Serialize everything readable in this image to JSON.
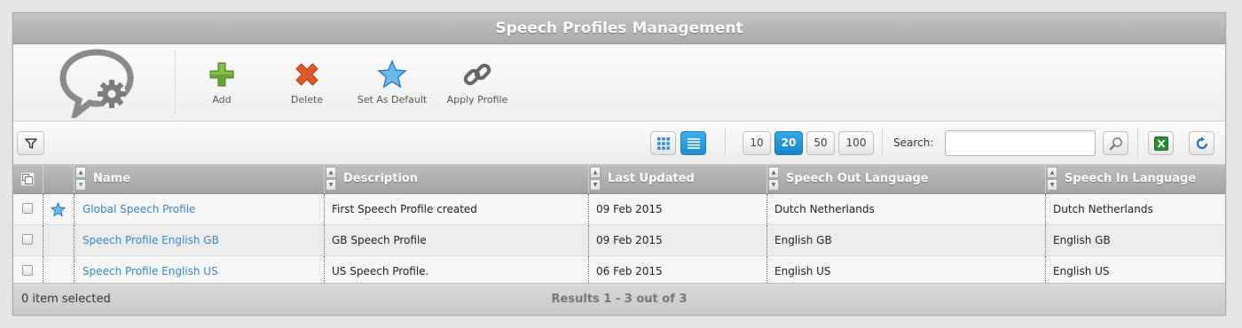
{
  "window": {
    "title": "Speech Profiles Management"
  },
  "toolbar": {
    "logo_icon": "speech-bubble-gear-icon",
    "buttons": [
      {
        "label": "Add",
        "icon": "add-icon"
      },
      {
        "label": "Delete",
        "icon": "delete-icon"
      },
      {
        "label": "Set As Default",
        "icon": "star-icon"
      },
      {
        "label": "Apply Profile",
        "icon": "chain-link-icon"
      }
    ]
  },
  "gridbar": {
    "filter_icon": "filter-icon",
    "view_modes": [
      {
        "icon": "grid-view-icon",
        "active": false
      },
      {
        "icon": "list-view-icon",
        "active": true
      }
    ],
    "page_sizes": [
      "10",
      "20",
      "50",
      "100"
    ],
    "selected_page_size": "20",
    "search_label": "Search:",
    "search_value": "",
    "search_icon": "magnifier-icon",
    "export_icon": "excel-icon",
    "refresh_icon": "refresh-icon"
  },
  "table": {
    "select_all_icon": "select-all-icon",
    "columns": [
      "Name",
      "Description",
      "Last Updated",
      "Speech Out Language",
      "Speech In Language"
    ],
    "rows": [
      {
        "default": true,
        "name": "Global Speech Profile",
        "description": "First Speech Profile created",
        "last_updated": "09 Feb 2015",
        "speech_out": "Dutch Netherlands",
        "speech_in": "Dutch Netherlands"
      },
      {
        "default": false,
        "name": "Speech Profile English GB",
        "description": "GB Speech Profile",
        "last_updated": "09 Feb 2015",
        "speech_out": "English GB",
        "speech_in": "English GB"
      },
      {
        "default": false,
        "name": "Speech Profile English US",
        "description": "US Speech Profile.",
        "last_updated": "06 Feb 2015",
        "speech_out": "English US",
        "speech_in": "English US"
      }
    ]
  },
  "footer": {
    "selection_status": "0 item selected",
    "results_text": "Results 1 - 3 out of 3"
  },
  "colors": {
    "accent": "#1c8fd0",
    "link": "#3a87c2",
    "header_bg": "#aaaaaa"
  }
}
